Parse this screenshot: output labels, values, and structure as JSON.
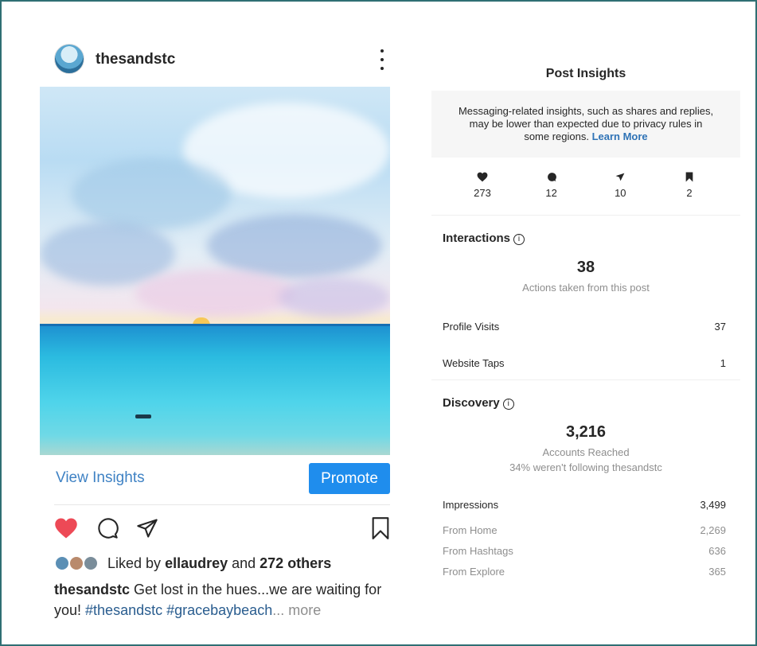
{
  "post": {
    "username": "thesandstc",
    "view_insights_label": "View Insights",
    "promote_label": "Promote",
    "liked_prefix": "Liked by ",
    "liked_user": "ellaudrey",
    "liked_mid": " and ",
    "liked_others": "272 others",
    "caption_user": "thesandstc",
    "caption_text": " Get lost in the hues...we are waiting for you! ",
    "caption_tags": "#thesandstc #gracebaybeach",
    "caption_more": "... more",
    "icons": [
      "heart-filled-icon",
      "comment-icon",
      "share-icon",
      "bookmark-icon"
    ],
    "colors": {
      "heart": "#ed4956",
      "link": "#3f82c4",
      "promote": "#1f8ded"
    }
  },
  "insights": {
    "title": "Post Insights",
    "notice_text": "Messaging-related insights, such as shares and replies, may be lower than expected due to privacy rules in some regions. ",
    "notice_link": "Learn More",
    "stats": [
      {
        "icon": "heart-icon",
        "value": "273"
      },
      {
        "icon": "comment-icon",
        "value": "12"
      },
      {
        "icon": "share-icon",
        "value": "10"
      },
      {
        "icon": "bookmark-icon",
        "value": "2"
      }
    ],
    "interactions": {
      "heading": "Interactions",
      "total": "38",
      "total_label": "Actions taken from this post",
      "rows": [
        {
          "label": "Profile Visits",
          "value": "37"
        },
        {
          "label": "Website Taps",
          "value": "1"
        }
      ]
    },
    "discovery": {
      "heading": "Discovery",
      "total": "3,216",
      "total_label": "Accounts Reached",
      "following_note": "34% weren't following thesandstc",
      "impressions": {
        "label": "Impressions",
        "value": "3,499"
      },
      "sources": [
        {
          "label": "From Home",
          "value": "2,269"
        },
        {
          "label": "From Hashtags",
          "value": "636"
        },
        {
          "label": "From Explore",
          "value": "365"
        }
      ]
    }
  }
}
